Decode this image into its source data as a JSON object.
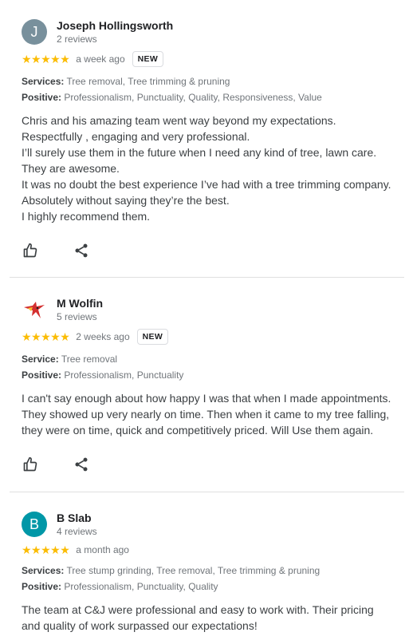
{
  "reviews": [
    {
      "avatar_letter": "J",
      "name": "Joseph Hollingsworth",
      "review_count": "2 reviews",
      "stars": "★★★★★",
      "rating": 5,
      "date": "a week ago",
      "badge": "NEW",
      "services_label": "Services:",
      "services": "Tree removal, Tree trimming & pruning",
      "positive_label": "Positive:",
      "positive": "Professionalism, Punctuality, Quality, Responsiveness, Value",
      "lines": [
        "Chris and his amazing team went way beyond my expectations.",
        "Respectfully , engaging and very professional.",
        "I’ll surely use them in the future when I need any kind of tree, lawn care.",
        "They are awesome.",
        "It was no doubt the best experience I’ve had with a tree trimming company.",
        "Absolutely without saying they’re the best.",
        "I highly recommend them."
      ]
    },
    {
      "name": "M Wolfin",
      "review_count": "5 reviews",
      "stars": "★★★★★",
      "rating": 5,
      "date": "2 weeks ago",
      "badge": "NEW",
      "services_label": "Service:",
      "services": "Tree removal",
      "positive_label": "Positive:",
      "positive": "Professionalism, Punctuality",
      "lines": [
        "I can't say enough about how happy I was that when I made appointments.",
        "They showed up very nearly on time. Then when it came to my tree falling,",
        "they were on time, quick and competitively priced. Will Use them again."
      ]
    },
    {
      "avatar_letter": "B",
      "name": "B Slab",
      "review_count": "4 reviews",
      "stars": "★★★★★",
      "rating": 5,
      "date": "a month ago",
      "services_label": "Services:",
      "services": "Tree stump grinding, Tree removal, Tree trimming & pruning",
      "positive_label": "Positive:",
      "positive": "Professionalism, Punctuality, Quality",
      "lines": [
        "The team at C&J were professional and easy to work with. Their pricing",
        "and quality of work surpassed our expectations!"
      ]
    }
  ],
  "icons": {
    "like": "thumbs-up-icon",
    "share": "share-icon"
  },
  "colors": {
    "star": "#fbbc04",
    "avatar_j": "#78909c",
    "avatar_b": "#0097a7"
  }
}
